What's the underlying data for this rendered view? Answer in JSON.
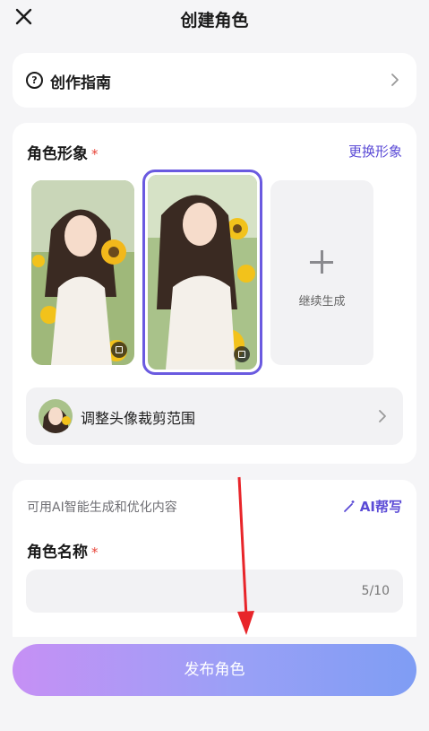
{
  "header": {
    "title": "创建角色",
    "close_icon": "close-icon"
  },
  "guide": {
    "label": "创作指南",
    "icon": "question-circle-icon",
    "chevron": "chevron-right-icon"
  },
  "appearance": {
    "title": "角色形象",
    "required_mark": "*",
    "change_link": "更换形象",
    "generate_more_label": "继续生成",
    "selected_index": 1,
    "adjust_crop_label": "调整头像裁剪范围"
  },
  "name_section": {
    "ai_hint": "可用AI智能生成和优化内容",
    "ai_help_label": "AI帮写",
    "title": "角色名称",
    "required_mark": "*",
    "input_value": "",
    "counter": "5/10"
  },
  "publish": {
    "label": "发布角色"
  },
  "colors": {
    "accent": "#5b4bd6",
    "required": "#e8463a",
    "selected_border": "#6a5ae0",
    "annotation_arrow": "#e8252a"
  }
}
